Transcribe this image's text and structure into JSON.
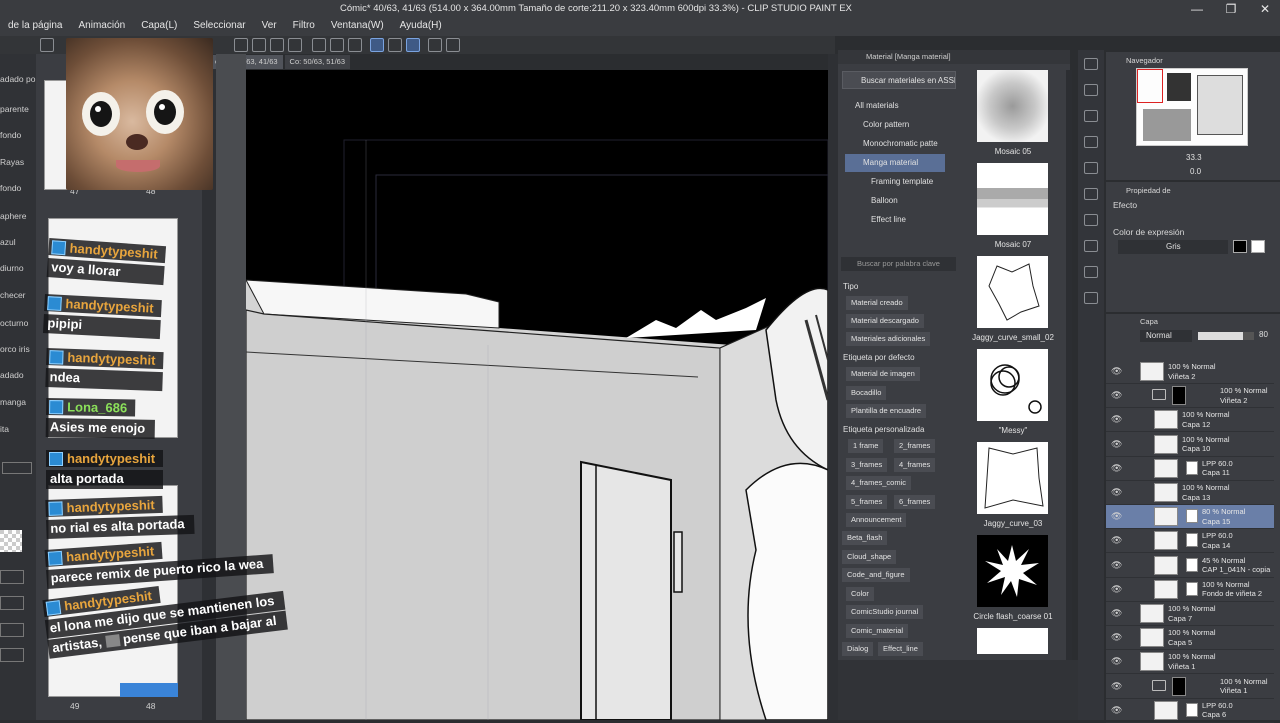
{
  "window": {
    "title": "Cómic* 40/63, 41/63 (514.00 x 364.00mm Tamaño de corte:211.20 x 323.40mm 600dpi 33.3%) - CLIP STUDIO PAINT EX",
    "controls": [
      "—",
      "❐",
      "✕"
    ]
  },
  "menu": [
    "de la página",
    "Animación",
    "Capa(L)",
    "Seleccionar",
    "Ver",
    "Filtro",
    "Ventana(W)",
    "Ayuda(H)"
  ],
  "tabs": [
    "omic* 40/63, 41/63",
    "Co: 50/63, 51/63"
  ],
  "left_labels": [
    "adado por",
    "parente",
    "fondo",
    "Rayas",
    "fondo",
    "aphere",
    "azul",
    "diurno",
    "checer",
    "octurno",
    "orco iris",
    "adado",
    "manga",
    "ita"
  ],
  "page_numbers": [
    "47",
    "48",
    "49",
    "48"
  ],
  "chat": [
    {
      "user": "handytypeshit",
      "text": "voy a llorar",
      "user_color": "#e8a53d"
    },
    {
      "user": "handytypeshit",
      "text": "pipipi",
      "user_color": "#e8a53d"
    },
    {
      "user": "handytypeshit",
      "text": "ndea",
      "user_color": "#e8a53d"
    },
    {
      "user": "Lona_686",
      "text": "Asies me enojo",
      "user_color": "#8be05a"
    },
    {
      "user": "handytypeshit",
      "text": "alta portada",
      "user_color": "#e8a53d"
    },
    {
      "user": "handytypeshit",
      "text": "no rial es alta portada",
      "user_color": "#e8a53d"
    },
    {
      "user": "handytypeshit",
      "text": "parece remix de puerto rico la wea",
      "user_color": "#e8a53d"
    },
    {
      "user": "handytypeshit",
      "text_line1": "el lona me dijo que se mantienen los",
      "text_line2": "artistas,",
      "text_line3": "pense que iban a bajar al",
      "user_color": "#e8a53d"
    }
  ],
  "material": {
    "header": "Material [Manga material]",
    "search_button": "Buscar materiales en ASSETS",
    "tree": [
      "All materials",
      "Color pattern",
      "Monochromatic patte",
      "Manga material",
      "Framing template",
      "Balloon",
      "Effect line"
    ],
    "keyword_placeholder": "Buscar por palabra clave",
    "tipo_head": "Tipo",
    "tipo": [
      "Material creado",
      "Material descargado",
      "Materiales adicionales"
    ],
    "default_tag_head": "Etiqueta por defecto",
    "default_tags": [
      "Material de imagen",
      "Bocadillo",
      "Plantilla de encuadre"
    ],
    "custom_tag_head": "Etiqueta personalizada",
    "custom_tags": [
      [
        "1 frame",
        "2_frames"
      ],
      [
        "3_frames",
        "4_frames"
      ],
      [
        "4_frames_comic"
      ],
      [
        "5_frames",
        "6_frames"
      ],
      [
        "Announcement"
      ],
      [
        "Beta_flash"
      ],
      [
        "Cloud_shape"
      ],
      [
        "Code_and_figure"
      ],
      [
        "Color"
      ],
      [
        "ComicStudio journal"
      ],
      [
        "Comic_material"
      ],
      [
        "Dialog",
        "Effect_line"
      ]
    ],
    "items": [
      "Mosaic 05",
      "Mosaic 07",
      "Jaggy_curve_small_02",
      "\"Messy\"",
      "Jaggy_curve_03",
      "Circle flash_coarse 01"
    ]
  },
  "navigator": {
    "title": "Navegador",
    "zoom": "33.3",
    "rotation": "0.0"
  },
  "properties": {
    "title": "Propiedad de",
    "effect_label": "Efecto",
    "expression_label": "Color de expresión",
    "expression_value": "Gris"
  },
  "layers": {
    "title": "Capa",
    "blend": "Normal",
    "opacity": "80",
    "rows": [
      {
        "line1": "100 % Normal",
        "line2": "Viñeta 2",
        "type": "layer",
        "indent": 0
      },
      {
        "line1": "100 % Normal",
        "line2": "Viñeta 2",
        "type": "folder",
        "indent": 0
      },
      {
        "line1": "100 % Normal",
        "line2": "Capa 12",
        "type": "layer",
        "indent": 1
      },
      {
        "line1": "100 % Normal",
        "line2": "Capa 10",
        "type": "layer",
        "indent": 1
      },
      {
        "line1": "LPP 60.0",
        "line2": "Capa 11",
        "type": "masked",
        "indent": 1
      },
      {
        "line1": "100 % Normal",
        "line2": "Capa 13",
        "type": "layer",
        "indent": 1
      },
      {
        "line1": "80 % Normal",
        "line2": "Capa 15",
        "type": "masked",
        "indent": 1,
        "selected": true
      },
      {
        "line1": "LPP 60.0",
        "line2": "Capa 14",
        "type": "masked",
        "indent": 1
      },
      {
        "line1": "45 % Normal",
        "line2": "CAP 1_041N - copia",
        "type": "masked",
        "indent": 1
      },
      {
        "line1": "100 % Normal",
        "line2": "Fondo de viñeta 2",
        "type": "masked",
        "indent": 1
      },
      {
        "line1": "100 % Normal",
        "line2": "Capa 7",
        "type": "layer",
        "indent": 0
      },
      {
        "line1": "100 % Normal",
        "line2": "Capa 5",
        "type": "layer",
        "indent": 0
      },
      {
        "line1": "100 % Normal",
        "line2": "Viñeta 1",
        "type": "layer",
        "indent": 0
      },
      {
        "line1": "100 % Normal",
        "line2": "Viñeta 1",
        "type": "folder",
        "indent": 0
      },
      {
        "line1": "LPP 60.0",
        "line2": "Capa 6",
        "type": "masked",
        "indent": 1
      }
    ]
  },
  "colors": {
    "accent_selected": "#6a7fa8",
    "username_orange": "#e8a53d",
    "username_green": "#8be05a"
  }
}
